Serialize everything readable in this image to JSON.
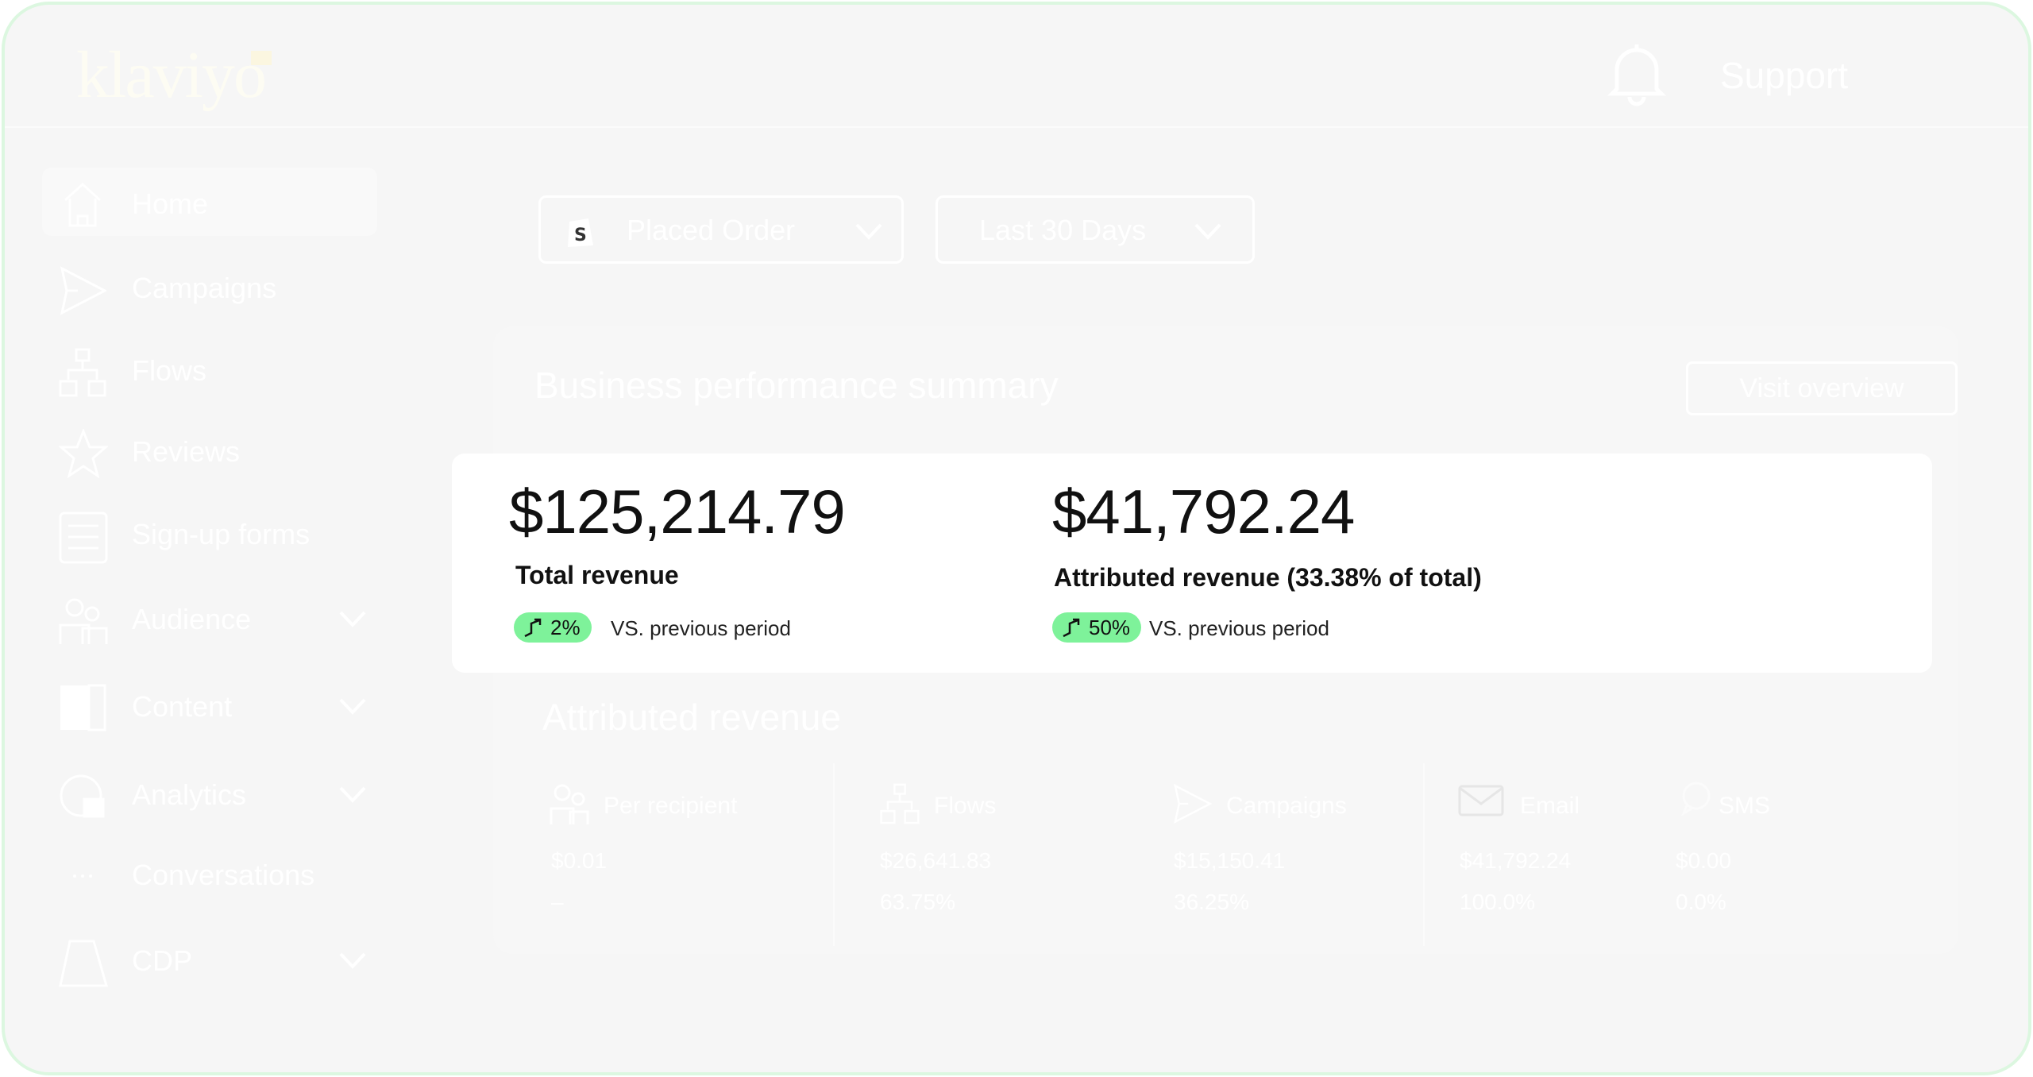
{
  "header": {
    "logo": "klaviyo",
    "support_label": "Support",
    "notifications_icon": "bell-icon"
  },
  "sidebar": {
    "items": [
      {
        "label": "Home",
        "icon": "home-icon",
        "active": true
      },
      {
        "label": "Campaigns",
        "icon": "send-icon"
      },
      {
        "label": "Flows",
        "icon": "flows-icon"
      },
      {
        "label": "Reviews",
        "icon": "star-icon"
      },
      {
        "label": "Sign-up forms",
        "icon": "form-icon"
      },
      {
        "label": "Audience",
        "icon": "people-icon",
        "expandable": true
      },
      {
        "label": "Content",
        "icon": "content-icon",
        "expandable": true
      },
      {
        "label": "Analytics",
        "icon": "chart-icon",
        "expandable": true
      },
      {
        "label": "Conversations",
        "icon": "chat-icon"
      },
      {
        "label": "CDP",
        "icon": "cdp-icon",
        "expandable": true
      }
    ]
  },
  "filters": {
    "metric": "Placed Order",
    "period": "Last 30 Days"
  },
  "summary": {
    "title": "Business performance summary",
    "visit_label": "Visit overview",
    "total": {
      "value": "$125,214.79",
      "label": "Total revenue",
      "change": "2%",
      "vs": "VS. previous period"
    },
    "attributed": {
      "value": "$41,792.24",
      "label": "Attributed revenue (33.38% of total)",
      "change": "50%",
      "vs": "VS. previous period"
    },
    "badge_color": "#7ef29a"
  },
  "attributed_revenue": {
    "title": "Attributed revenue",
    "per_recipient": {
      "label": "Per recipient",
      "value": "$0.01",
      "pct": "–"
    },
    "flows": {
      "label": "Flows",
      "value": "$26,641.83",
      "pct": "63.75%"
    },
    "campaigns": {
      "label": "Campaigns",
      "value": "$15,150.41",
      "pct": "36.25%"
    },
    "email": {
      "label": "Email",
      "value": "$41,792.24",
      "pct": "100.0%"
    },
    "sms": {
      "label": "SMS",
      "value": "$0.00",
      "pct": "0.0%"
    }
  }
}
